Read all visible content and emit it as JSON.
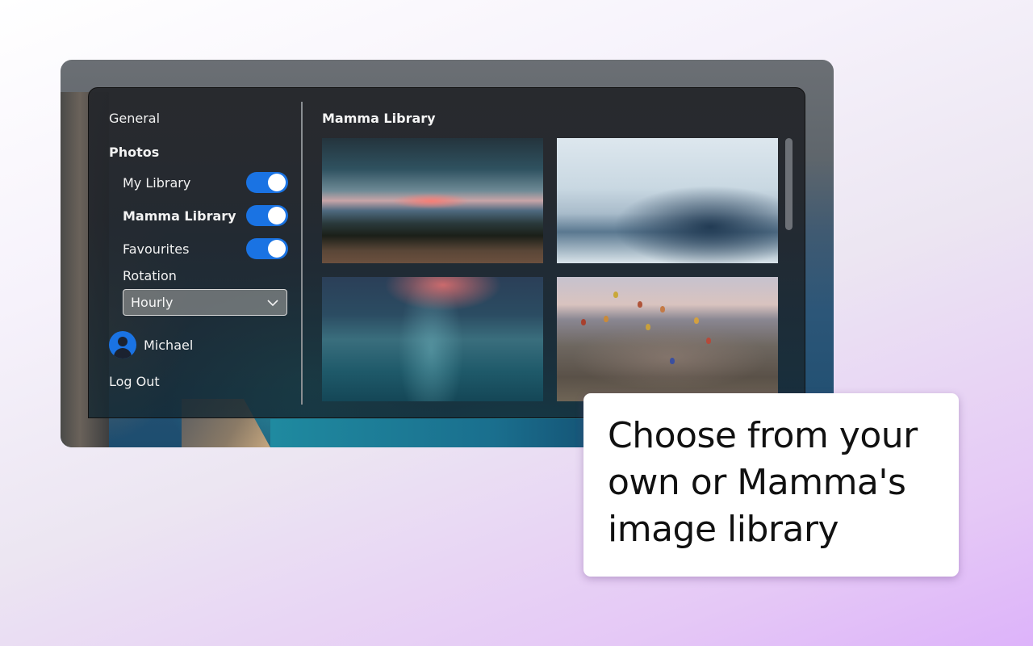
{
  "sidebar": {
    "general_label": "General",
    "photos_heading": "Photos",
    "libraries": [
      {
        "label": "My Library",
        "enabled": true,
        "bold": false
      },
      {
        "label": "Mamma Library",
        "enabled": true,
        "bold": true
      },
      {
        "label": "Favourites",
        "enabled": true,
        "bold": false
      }
    ],
    "rotation": {
      "label": "Rotation",
      "selected": "Hourly"
    },
    "user": {
      "name": "Michael",
      "avatar_icon": "user-avatar-icon"
    },
    "logout_label": "Log Out"
  },
  "main": {
    "title": "Mamma Library",
    "thumbnails": [
      {
        "description": "Mountain sunset with pink snowy peaks"
      },
      {
        "description": "Misty forest with clouds"
      },
      {
        "description": "Underwater sun rays"
      },
      {
        "description": "Hot air balloons over valley"
      }
    ]
  },
  "callout": {
    "lines": [
      "Choose from your",
      "own or Mamma's",
      "image library"
    ]
  },
  "colors": {
    "accent": "#1a73e3",
    "toggle_knob": "#ffffff",
    "callout_bg": "#ffffff"
  }
}
